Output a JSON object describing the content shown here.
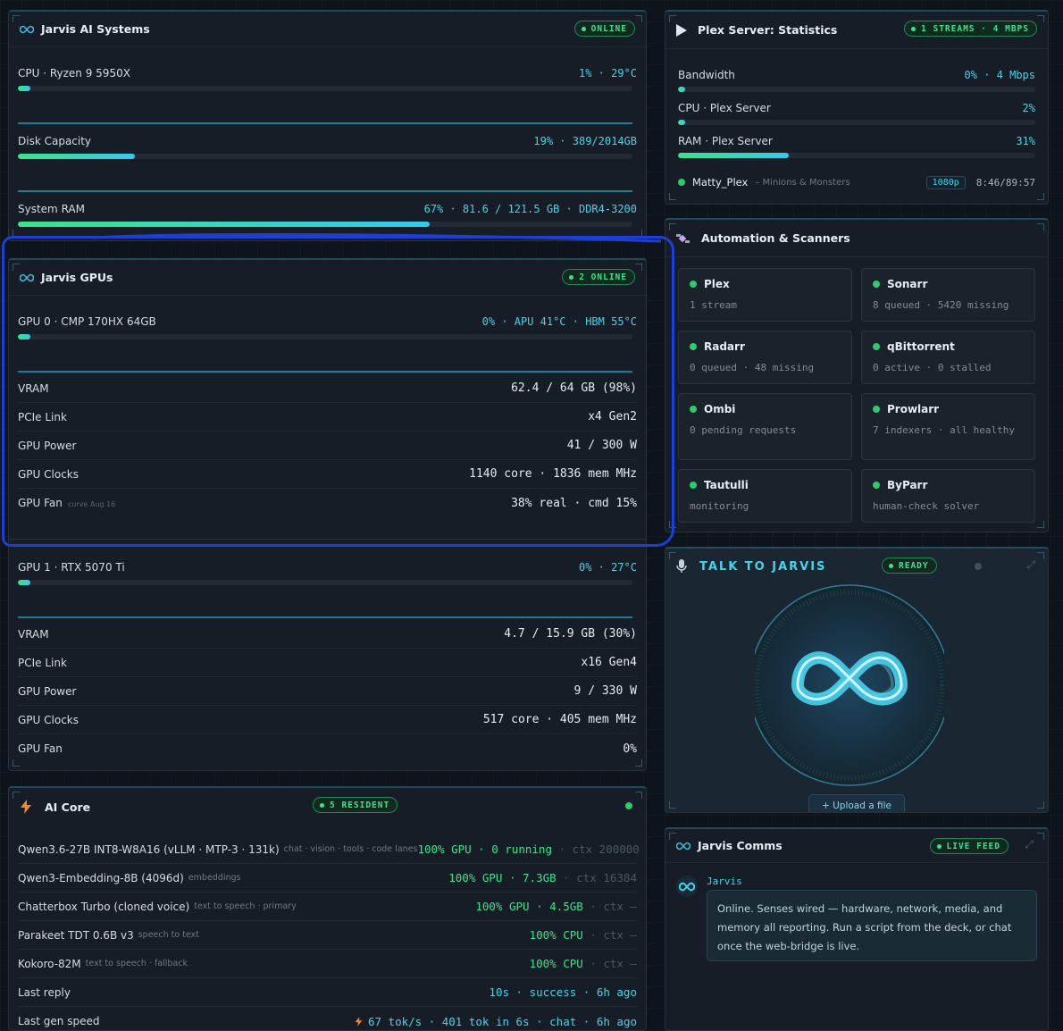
{
  "systems": {
    "title": "Jarvis AI Systems",
    "badge": "ONLINE",
    "cpu": {
      "label": "CPU · Ryzen 9 5950X",
      "value": "1% · 29°C",
      "fill": 0.02
    },
    "disk": {
      "label": "Disk Capacity",
      "value": "19% · 389/2014GB",
      "fill": 0.19
    },
    "ram": {
      "label": "System RAM",
      "value": "67% · 81.6 / 121.5 GB · DDR4-3200",
      "fill": 0.67
    }
  },
  "gpus": {
    "title": "Jarvis GPUs",
    "badge": "2 ONLINE",
    "gpu0": {
      "label": "GPU 0 · CMP 170HX 64GB",
      "value": "0% · APU 41°C · HBM 55°C",
      "fill": 0.02,
      "rows": [
        {
          "k": "VRAM",
          "v": "62.4 / 64 GB (98%)"
        },
        {
          "k": "PCIe Link",
          "v": "x4 Gen2"
        },
        {
          "k": "GPU Power",
          "v": "41 / 300 W"
        },
        {
          "k": "GPU Clocks",
          "v": "1140 core · 1836 mem MHz"
        },
        {
          "k": "GPU Fan",
          "v": "38% real · cmd 15%",
          "note": "curve Aug 16"
        }
      ]
    },
    "gpu1": {
      "label": "GPU 1 · RTX 5070 Ti",
      "value": "0% · 27°C",
      "fill": 0.02,
      "rows": [
        {
          "k": "VRAM",
          "v": "4.7 / 15.9 GB (30%)"
        },
        {
          "k": "PCIe Link",
          "v": "x16 Gen4"
        },
        {
          "k": "GPU Power",
          "v": "9 / 330 W"
        },
        {
          "k": "GPU Clocks",
          "v": "517 core · 405 mem MHz"
        },
        {
          "k": "GPU Fan",
          "v": "0%"
        }
      ]
    }
  },
  "core": {
    "title": "AI Core",
    "badge": "5 RESIDENT",
    "models": [
      {
        "name": "Qwen3.6-27B INT8-W8A16 (vLLM · MTP-3 · 131k)",
        "sub": "chat · vision · tools · code lanes",
        "stat": "100% GPU · 0 running",
        "ctx": "· ctx 200000"
      },
      {
        "name": "Qwen3-Embedding-8B (4096d)",
        "sub": "embeddings",
        "stat": "100% GPU · 7.3GB",
        "ctx": "· ctx 16384"
      },
      {
        "name": "Chatterbox Turbo (cloned voice)",
        "sub": "text to speech · primary",
        "stat": "100% GPU · 4.5GB",
        "ctx": "· ctx —"
      },
      {
        "name": "Parakeet TDT 0.6B v3",
        "sub": "speech to text",
        "stat": "100% CPU",
        "ctx": "· ctx —"
      },
      {
        "name": "Kokoro-82M",
        "sub": "text to speech · fallback",
        "stat": "100% CPU",
        "ctx": "· ctx —"
      }
    ],
    "last_reply": {
      "k": "Last reply",
      "v": "10s · success · 6h ago"
    },
    "last_gen": {
      "k": "Last gen speed",
      "v": "67 tok/s · 401 tok in 6s · chat · 6h ago"
    }
  },
  "plex": {
    "title": "Plex Server: Statistics",
    "badge": "1 STREAMS · 4 MBPS",
    "bandwidth": {
      "label": "Bandwidth",
      "value": "0% · 4 Mbps",
      "fill": 0.02
    },
    "cpu": {
      "label": "CPU · Plex Server",
      "value": "2%",
      "fill": 0.02
    },
    "ram": {
      "label": "RAM · Plex Server",
      "value": "31%",
      "fill": 0.31
    },
    "stream": {
      "user": "Matty_Plex",
      "title": "– Minions & Monsters",
      "quality": "1080p",
      "time": "8:46/89:57"
    }
  },
  "automation": {
    "title": "Automation & Scanners",
    "services": [
      {
        "name": "Plex",
        "status": "1 stream"
      },
      {
        "name": "Sonarr",
        "status": "8 queued · 5420 missing"
      },
      {
        "name": "Radarr",
        "status": "0 queued · 48 missing"
      },
      {
        "name": "qBittorrent",
        "status": "0 active · 0 stalled"
      },
      {
        "name": "Ombi",
        "status": "0 pending requests"
      },
      {
        "name": "Prowlarr",
        "status": "7 indexers · all healthy"
      },
      {
        "name": "Tautulli",
        "status": "monitoring"
      },
      {
        "name": "ByParr",
        "status": "human-check solver"
      }
    ]
  },
  "talk": {
    "title": "TALK TO JARVIS",
    "badge": "READY",
    "upload": "+ Upload a file"
  },
  "comms": {
    "title": "Jarvis Comms",
    "badge": "LIVE FEED",
    "sender": "Jarvis",
    "message": "Online. Senses wired — hardware, network, media, and memory all reporting. Run a script from the deck, or chat once the web-bridge is live."
  }
}
